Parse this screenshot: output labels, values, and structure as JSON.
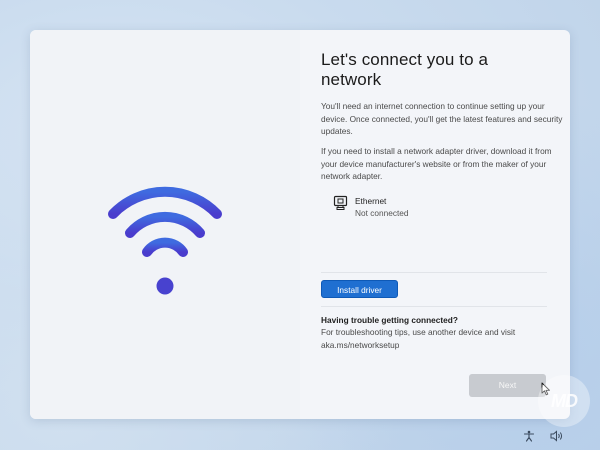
{
  "oobe": {
    "title": "Let's connect you to a network",
    "para1": "You'll need an internet connection to continue setting up your device. Once connected, you'll get the latest features and security updates.",
    "para2": "If you need to install a network adapter driver, download it from your device manufacturer's website or from the maker of your network adapter.",
    "network": {
      "icon": "ethernet-icon",
      "name": "Ethernet",
      "status": "Not connected"
    },
    "install_label": "Install driver",
    "trouble_title": "Having trouble getting connected?",
    "trouble_text": "For troubleshooting tips, use another device and visit aka.ms/networksetup",
    "next_label": "Next"
  },
  "watermark_text": "MD",
  "icons": {
    "hero": "wifi-icon",
    "tray": [
      "accessibility-icon",
      "volume-icon"
    ],
    "pointer": "mouse-cursor-icon"
  },
  "colors": {
    "accent": "#1f6fd1",
    "wifi_gradient_top": "#3a5fd8",
    "wifi_gradient_bottom": "#5a3fcf",
    "disabled_button": "#c8cbd0"
  }
}
